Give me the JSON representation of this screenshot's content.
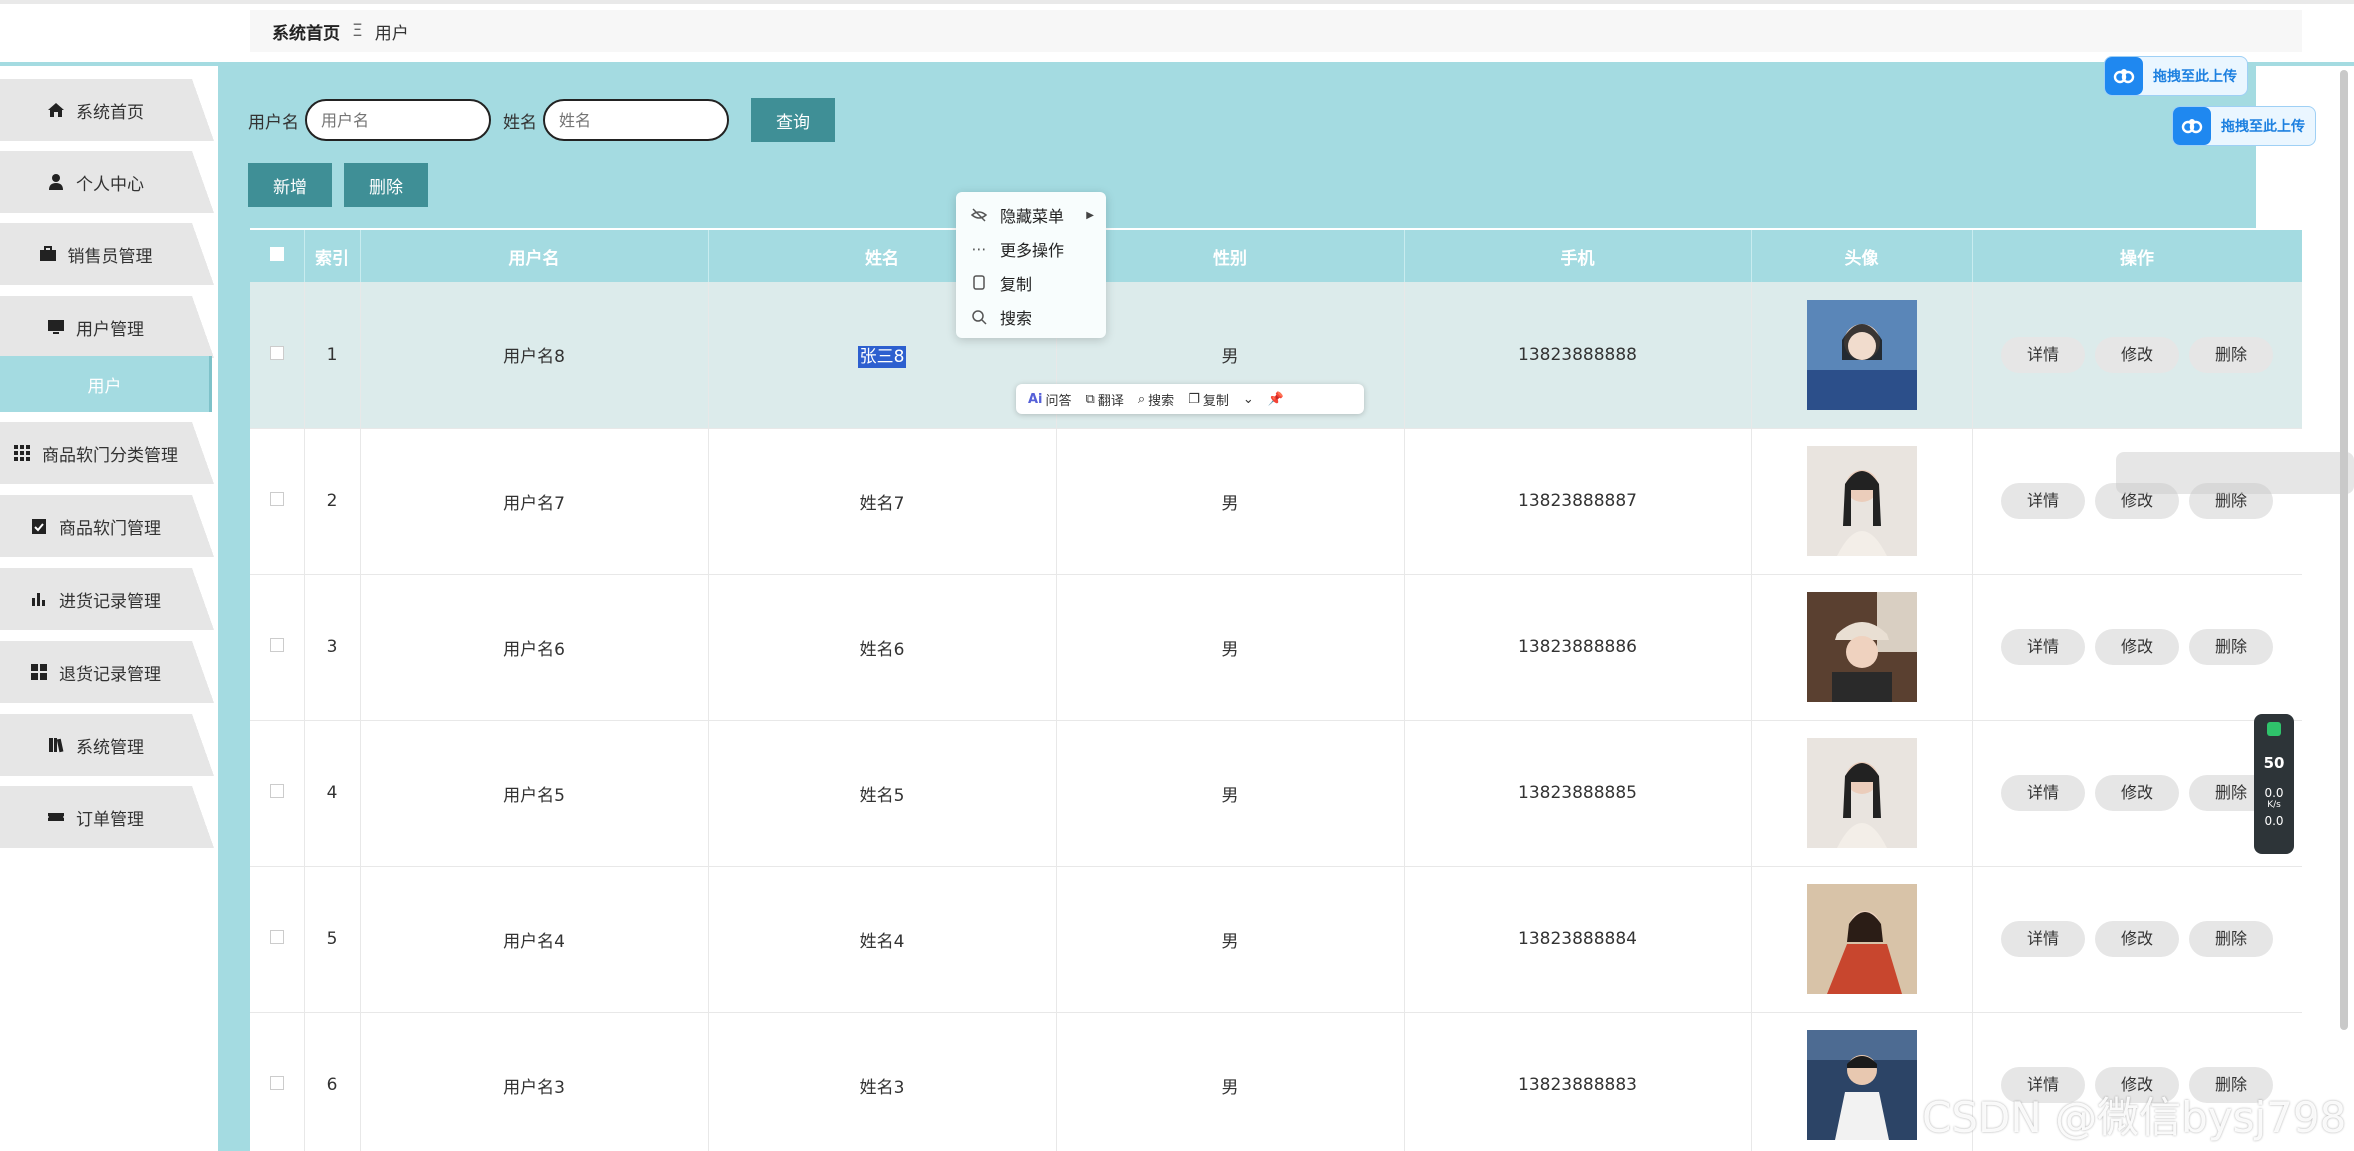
{
  "breadcrumb": {
    "home": "系统首页",
    "separator": "Ξ",
    "current": "用户"
  },
  "sidebar": {
    "items": [
      {
        "label": "系统首页",
        "icon": "home-icon"
      },
      {
        "label": "个人中心",
        "icon": "user-icon"
      },
      {
        "label": "销售员管理",
        "icon": "briefcase-icon"
      },
      {
        "label": "用户管理",
        "icon": "monitor-icon"
      },
      {
        "label": "商品软门分类管理",
        "icon": "grid-icon"
      },
      {
        "label": "商品软门管理",
        "icon": "clipboard-icon"
      },
      {
        "label": "进货记录管理",
        "icon": "bar-chart-icon"
      },
      {
        "label": "退货记录管理",
        "icon": "tiles-icon"
      },
      {
        "label": "系统管理",
        "icon": "books-icon"
      },
      {
        "label": "订单管理",
        "icon": "ticket-icon"
      }
    ],
    "sub_active": "用户"
  },
  "search": {
    "username_label": "用户名",
    "username_placeholder": "用户名",
    "name_label": "姓名",
    "name_placeholder": "姓名",
    "query_button": "查询"
  },
  "actions": {
    "add": "新增",
    "delete": "删除"
  },
  "table": {
    "headers": [
      "索引",
      "用户名",
      "姓名",
      "性别",
      "手机",
      "头像",
      "操作"
    ],
    "rows": [
      {
        "index": "1",
        "username": "用户名8",
        "name": "张三8",
        "gender": "男",
        "phone": "13823888888"
      },
      {
        "index": "2",
        "username": "用户名7",
        "name": "姓名7",
        "gender": "男",
        "phone": "13823888887"
      },
      {
        "index": "3",
        "username": "用户名6",
        "name": "姓名6",
        "gender": "男",
        "phone": "13823888886"
      },
      {
        "index": "4",
        "username": "用户名5",
        "name": "姓名5",
        "gender": "男",
        "phone": "13823888885"
      },
      {
        "index": "5",
        "username": "用户名4",
        "name": "姓名4",
        "gender": "男",
        "phone": "13823888884"
      },
      {
        "index": "6",
        "username": "用户名3",
        "name": "姓名3",
        "gender": "男",
        "phone": "13823888883"
      }
    ],
    "op_buttons": {
      "detail": "详情",
      "edit": "修改",
      "delete": "删除"
    }
  },
  "context_menu": {
    "items": [
      {
        "label": "隐藏菜单",
        "icon": "eye-off-icon"
      },
      {
        "label": "更多操作",
        "icon": "ellipsis-icon"
      },
      {
        "label": "复制",
        "icon": "copy-icon"
      },
      {
        "label": "搜索",
        "icon": "search-icon"
      }
    ]
  },
  "selection_toolbar": {
    "ask": "问答",
    "translate": "翻译",
    "search": "搜索",
    "copy": "复制"
  },
  "upload_badge": {
    "label": "拖拽至此上传"
  },
  "speed_widget": {
    "percent": "50",
    "up": "0.0",
    "down": "0.0",
    "unit": "K/s"
  },
  "watermark": "CSDN @微信bysj798",
  "colors": {
    "accent": "#a4dbe1",
    "button": "#3f8f96",
    "selection": "#2d5fcf"
  }
}
